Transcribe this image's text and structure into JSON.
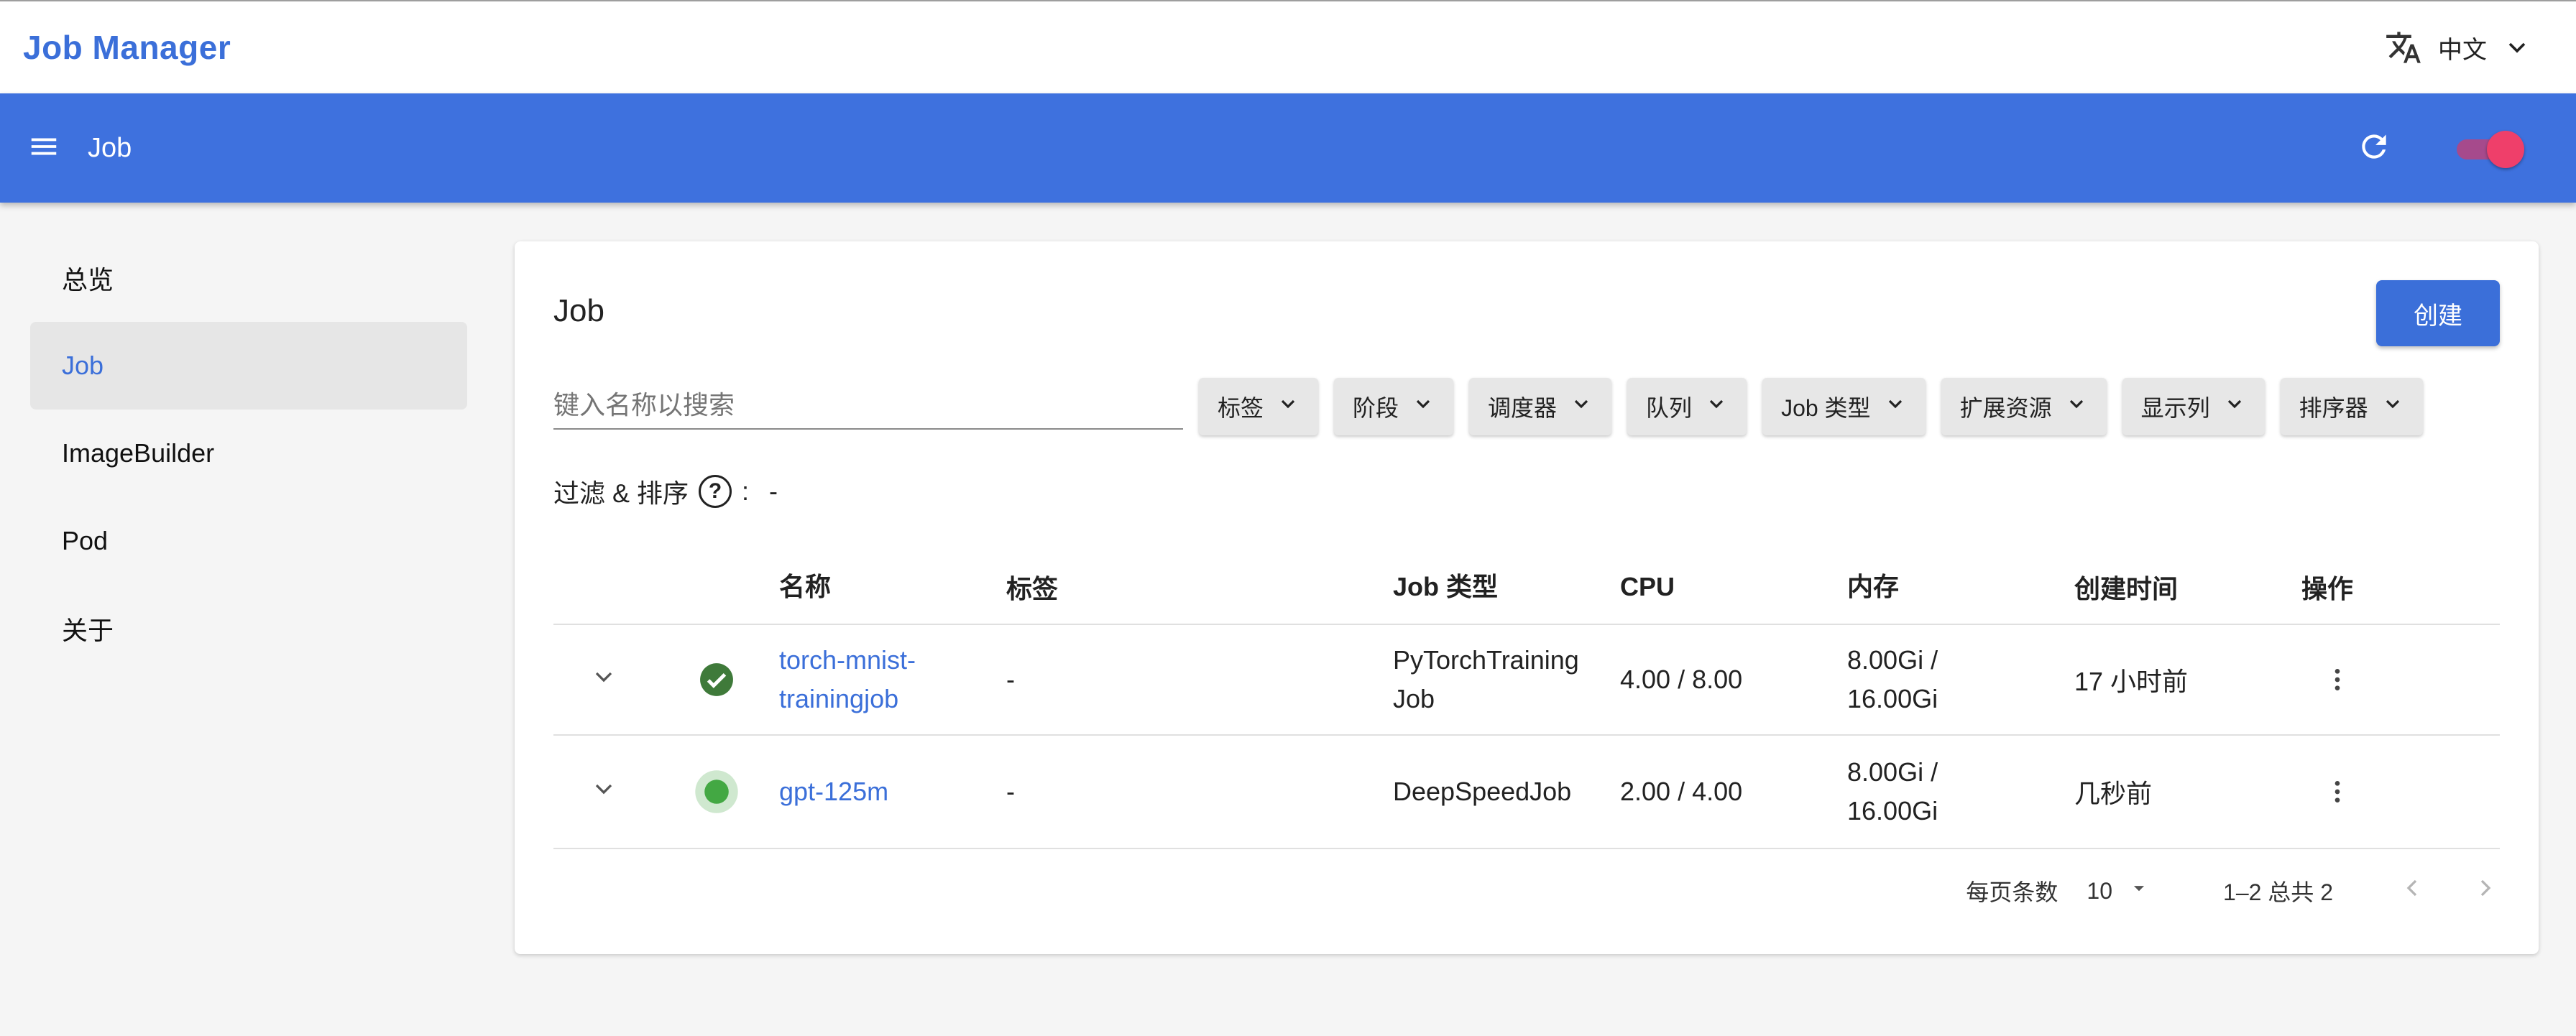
{
  "brand": "Job Manager",
  "language": {
    "label": "中文",
    "icon": "translate-icon"
  },
  "appbar": {
    "title": "Job",
    "icons": [
      "menu-icon",
      "refresh-icon"
    ],
    "toggle_on": true
  },
  "sidebar": {
    "items": [
      {
        "label": "总览",
        "active": false
      },
      {
        "label": "Job",
        "active": true
      },
      {
        "label": "ImageBuilder",
        "active": false
      },
      {
        "label": "Pod",
        "active": false
      },
      {
        "label": "关于",
        "active": false
      }
    ]
  },
  "main": {
    "title": "Job",
    "create_label": "创建",
    "search_placeholder": "键入名称以搜索",
    "filters": [
      "标签",
      "阶段",
      "调度器",
      "队列",
      "Job 类型",
      "扩展资源",
      "显示列",
      "排序器"
    ],
    "filter_state_label": "过滤 & 排序",
    "filter_state_value": "-",
    "table": {
      "columns": [
        "名称",
        "标签",
        "Job 类型",
        "CPU",
        "内存",
        "创建时间",
        "操作"
      ],
      "rows": [
        {
          "status": "succeeded",
          "name": "torch-mnist-trainingjob",
          "name_l1": "torch-mnist-",
          "name_l2": "trainingjob",
          "labels": "-",
          "type_l1": "PyTorchTraining",
          "type_l2": "Job",
          "cpu": "4.00 / 8.00",
          "mem_l1": "8.00Gi /",
          "mem_l2": "16.00Gi",
          "created": "17 小时前"
        },
        {
          "status": "running",
          "name": "gpt-125m",
          "labels": "-",
          "type": "DeepSpeedJob",
          "cpu": "2.00 / 4.00",
          "mem_l1": "8.00Gi /",
          "mem_l2": "16.00Gi",
          "created": "几秒前"
        }
      ]
    },
    "pagination": {
      "rows_per_page_label": "每页条数",
      "rows_per_page": "10",
      "range": "1–2 总共 2"
    }
  },
  "colors": {
    "primary": "#3e71de",
    "success": "#3f7a3a",
    "running": "#43a843",
    "toggle": "#ef3f6a"
  }
}
